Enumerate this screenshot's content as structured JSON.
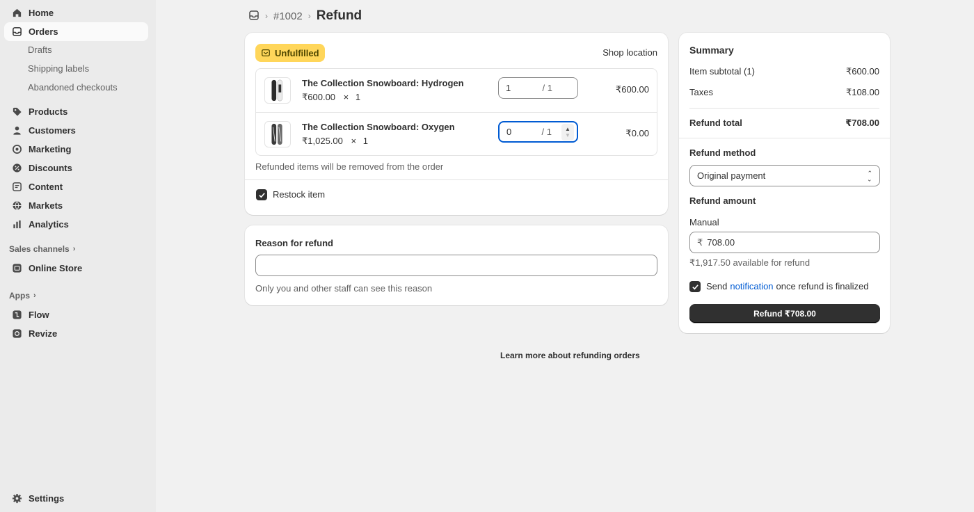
{
  "sidebar": {
    "home": "Home",
    "orders": "Orders",
    "drafts": "Drafts",
    "shipping_labels": "Shipping labels",
    "abandoned_checkouts": "Abandoned checkouts",
    "products": "Products",
    "customers": "Customers",
    "marketing": "Marketing",
    "discounts": "Discounts",
    "content": "Content",
    "markets": "Markets",
    "analytics": "Analytics",
    "sales_channels": "Sales channels",
    "online_store": "Online Store",
    "apps": "Apps",
    "flow": "Flow",
    "revize": "Revize",
    "settings": "Settings"
  },
  "breadcrumb": {
    "order": "#1002",
    "title": "Refund"
  },
  "fulfillment": {
    "badge": "Unfulfilled",
    "location": "Shop location",
    "items": [
      {
        "name": "The Collection Snowboard: Hydrogen",
        "price": "₹600.00",
        "times": "×",
        "quantity": "1",
        "refund_qty": "1",
        "max_qty": "/ 1",
        "total": "₹600.00"
      },
      {
        "name": "The Collection Snowboard: Oxygen",
        "price": "₹1,025.00",
        "times": "×",
        "quantity": "1",
        "refund_qty": "0",
        "max_qty": "/ 1",
        "total": "₹0.00"
      }
    ],
    "removed_note": "Refunded items will be removed from the order",
    "restock_label": "Restock item",
    "restock_checked": true
  },
  "reason": {
    "label": "Reason for refund",
    "value": "",
    "help": "Only you and other staff can see this reason"
  },
  "summary": {
    "title": "Summary",
    "subtotal_label": "Item subtotal (1)",
    "subtotal_value": "₹600.00",
    "taxes_label": "Taxes",
    "taxes_value": "₹108.00",
    "total_label": "Refund total",
    "total_value": "₹708.00",
    "method_label": "Refund method",
    "method_value": "Original payment",
    "amount_label": "Refund amount",
    "manual_label": "Manual",
    "currency_symbol": "₹",
    "amount_value": "708.00",
    "available": "₹1,917.50 available for refund",
    "send_prefix": "Send",
    "notification_link": "notification",
    "send_suffix": "once refund is finalized",
    "notify_checked": true,
    "refund_button": "Refund ₹708.00"
  },
  "footer": {
    "learn_more": "Learn more about refunding orders"
  },
  "colors": {
    "accent": "#005bd3",
    "badge": "#ffd65a",
    "primary": "#303030"
  }
}
